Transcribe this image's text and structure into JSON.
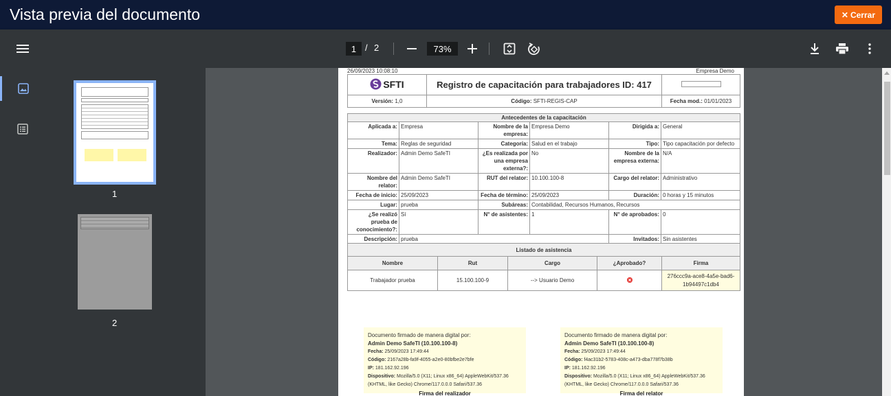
{
  "window": {
    "title": "Vista previa del documento",
    "close_label": "Cerrar"
  },
  "toolbar": {
    "current_page": "1",
    "separator": "/",
    "total_pages": "2",
    "zoom": "73%"
  },
  "thumbnails": [
    {
      "label": "1"
    },
    {
      "label": "2"
    }
  ],
  "doc": {
    "timestamp": "26/09/2023 10:08:10",
    "company_header": "Empresa Demo",
    "logo_text": "SFTI",
    "title": "Registro de capacitación para trabajadores ID: 417",
    "version_label": "Versión:",
    "version": "1,0",
    "code_label": "Código:",
    "code": "SFTI-REGIS-CAP",
    "mod_label": "Fecha mod.:",
    "mod_date": "01/01/2023",
    "antecedentes_title": "Antecedentes de la capacitación",
    "rows": [
      {
        "l1": "Aplicada a:",
        "v1": "Empresa",
        "l2": "Nombre de la empresa:",
        "v2": "Empresa Demo",
        "l3": "Dirigida a:",
        "v3": "General"
      },
      {
        "l1": "Tema:",
        "v1": "Reglas de seguridad",
        "l2": "Categoría:",
        "v2": "Salud en el trabajo",
        "l3": "Tipo:",
        "v3": "Tipo capacitación por defecto"
      },
      {
        "l1": "Realizador:",
        "v1": "Admin Demo SafeTI",
        "l2": "¿Es realizada por una empresa externa?:",
        "v2": "No",
        "l3": "Nombre de la empresa externa:",
        "v3": "N/A"
      },
      {
        "l1": "Nombre del relator:",
        "v1": "Admin Demo SafeTI",
        "l2": "RUT del relator:",
        "v2": "10.100.100-8",
        "l3": "Cargo del relator:",
        "v3": "Administrativo"
      },
      {
        "l1": "Fecha de inicio:",
        "v1": "25/09/2023",
        "l2": "Fecha de término:",
        "v2": "25/09/2023",
        "l3": "Duración:",
        "v3": "0 horas y 15 minutos"
      }
    ],
    "lugar_label": "Lugar:",
    "lugar": "prueba",
    "subareas_label": "Subáreas:",
    "subareas": "Contabilidad, Recursos Humanos, Recursos",
    "prueba_label": "¿Se realizó prueba de conocimiento?:",
    "prueba": "Sí",
    "asistentes_label": "N° de asistentes:",
    "asistentes": "1",
    "aprobados_label": "N° de aprobados:",
    "aprobados": "0",
    "descripcion_label": "Descripción:",
    "descripcion": "prueba",
    "invitados_label": "Invitados:",
    "invitados": "Sin asistentes",
    "listado_title": "Listado de asistencia",
    "listado_headers": [
      "Nombre",
      "Rut",
      "Cargo",
      "¿Aprobado?",
      "Firma"
    ],
    "listado_row": {
      "nombre": "Trabajador prueba",
      "rut": "15.100.100-9",
      "cargo": "--> Usuario Demo",
      "firma": "276ccc9a-ace8-4a5e-bad6-1b94497c1db4"
    },
    "signatures": [
      {
        "intro": "Documento firmado de manera digital por:",
        "name": "Admin Demo SafeTI (10.100.100-8)",
        "fecha_label": "Fecha:",
        "fecha": "25/09/2023 17:49:44",
        "codigo_label": "Código:",
        "codigo": "2167a28b-fa9f-4055-a2e0-80bfbe2e7bfe",
        "ip_label": "IP:",
        "ip": "181.162.92.196",
        "disp_label": "Dispositivo:",
        "disp": "Mozilla/5.0 (X11; Linux x86_64) AppleWebKit/537.36 (KHTML, like Gecko) Chrome/117.0.0.0 Safari/537.36",
        "title": "Firma del realizador"
      },
      {
        "intro": "Documento firmado de manera digital por:",
        "name": "Admin Demo SafeTI (10.100.100-8)",
        "fecha_label": "Fecha:",
        "fecha": "25/09/2023 17:49:44",
        "codigo_label": "Código:",
        "codigo": "f4ac31b2-5783-408c-a473-dba778f7b38b",
        "ip_label": "IP:",
        "ip": "181.162.92.196",
        "disp_label": "Dispositivo:",
        "disp": "Mozilla/5.0 (X11; Linux x86_64) AppleWebKit/537.36 (KHTML, like Gecko) Chrome/117.0.0.0 Safari/537.36",
        "title": "Firma del relator"
      }
    ]
  },
  "colors": {
    "topbar": "#0e1a36",
    "close_button": "#f36a10",
    "toolbar": "#323639",
    "viewer_bg": "#525659",
    "signature_bg": "#fffde0",
    "reject_icon": "#e53935"
  }
}
